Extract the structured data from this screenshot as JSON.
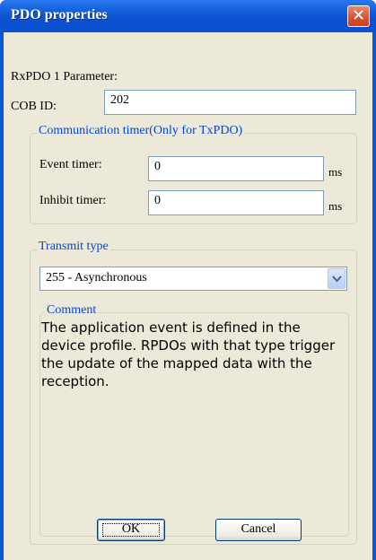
{
  "window": {
    "title": "PDO properties",
    "close_icon": "close-icon"
  },
  "param": {
    "heading": "RxPDO 1 Parameter:",
    "cob_label": "COB ID:",
    "cob_value": "202"
  },
  "comm_timer": {
    "legend": "Communication timer(Only for TxPDO)",
    "event_label": "Event timer:",
    "event_value": "0",
    "event_unit": "ms",
    "inhibit_label": "Inhibit timer:",
    "inhibit_value": "0",
    "inhibit_unit": "ms"
  },
  "transmit": {
    "legend": "Transmit type",
    "selected": "255 - Asynchronous",
    "comment_legend": "Comment",
    "comment_text": "The application event is defined in the device profile. RPDOs with that type trigger the update of the mapped data with the reception."
  },
  "buttons": {
    "ok": "OK",
    "cancel": "Cancel"
  },
  "colors": {
    "title_bar": "#0a57d8",
    "dialog_bg": "#ece9d8",
    "group_label": "#0046d5",
    "close_button": "#d8512e"
  }
}
